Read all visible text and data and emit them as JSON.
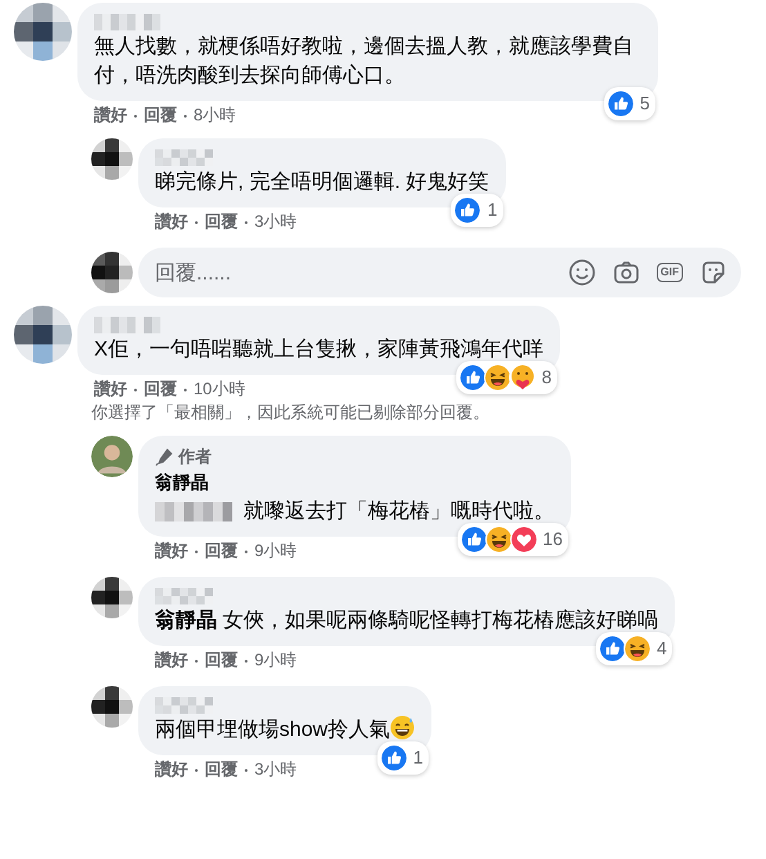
{
  "threads": [
    {
      "comment": {
        "kind": "user",
        "text": "無人找數，就梗係唔好教啦，邊個去搵人教，就應該學費自付，唔洗肉酸到去探向師傅心口。",
        "reactions": [
          {
            "kind": "like"
          }
        ],
        "reaction_count": "5",
        "like_action": "讚好",
        "reply_action": "回覆",
        "time": "8小時"
      },
      "replies": [
        {
          "kind": "user",
          "text": "睇完條片, 完全唔明個邏輯. 好鬼好笑",
          "reactions": [
            {
              "kind": "like"
            }
          ],
          "reaction_count": "1",
          "like_action": "讚好",
          "reply_action": "回覆",
          "time": "3小時"
        }
      ],
      "reply_box": {
        "placeholder": "回覆......",
        "gif_label": "GIF"
      }
    },
    {
      "comment": {
        "kind": "user",
        "text": "X佢，一句唔啱聽就上台隻揪，家陣黃飛鴻年代咩",
        "reactions": [
          {
            "kind": "like"
          },
          {
            "kind": "haha"
          },
          {
            "kind": "care"
          }
        ],
        "reaction_count": "8",
        "like_action": "讚好",
        "reply_action": "回覆",
        "time": "10小時"
      },
      "notice": "你選擇了「最相關」，因此系統可能已剔除部分回覆。",
      "replies": [
        {
          "kind": "author",
          "author_badge": "作者",
          "author": "翁靜晶",
          "text": "就嚟返去打「梅花樁」嘅時代啦。",
          "reactions": [
            {
              "kind": "like"
            },
            {
              "kind": "haha"
            },
            {
              "kind": "love"
            }
          ],
          "reaction_count": "16",
          "like_action": "讚好",
          "reply_action": "回覆",
          "time": "9小時"
        },
        {
          "kind": "user",
          "text": "**翁靜晶** 女俠，如果呢兩條騎呢怪轉打梅花樁應該好睇喎",
          "reactions": [
            {
              "kind": "like"
            },
            {
              "kind": "haha"
            }
          ],
          "reaction_count": "4",
          "like_action": "讚好",
          "reply_action": "回覆",
          "time": "9小時"
        },
        {
          "kind": "user",
          "text": "兩個甲埋做場show拎人氣",
          "trailing_emoji": true,
          "reactions": [
            {
              "kind": "like"
            }
          ],
          "reaction_count": "1",
          "like_action": "讚好",
          "reply_action": "回覆",
          "time": "3小時"
        }
      ]
    }
  ]
}
